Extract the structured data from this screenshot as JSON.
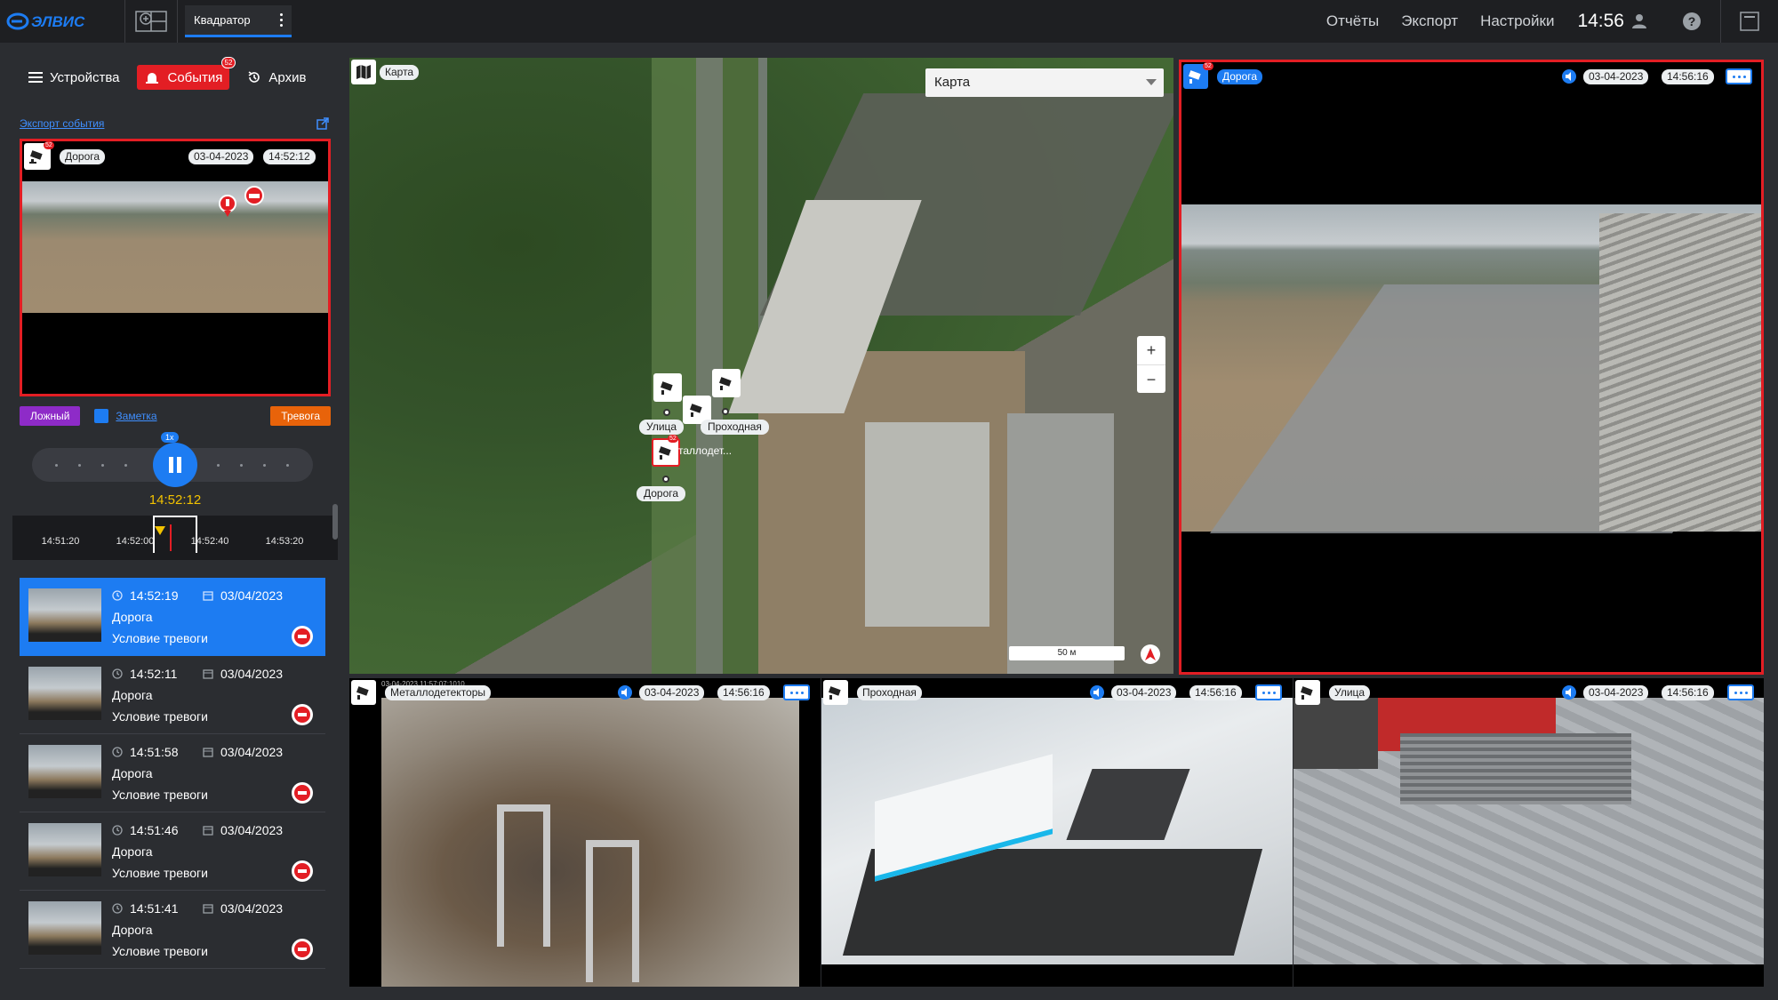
{
  "app": {
    "logo_text": "ЭЛВИС",
    "layout_tab": "Квадратор",
    "nav": [
      "Отчёты",
      "Экспорт",
      "Настройки"
    ],
    "clock": "14:56",
    "help": "?"
  },
  "left": {
    "tabs": [
      {
        "label": "Устройства",
        "icon": "menu-icon"
      },
      {
        "label": "События",
        "icon": "alarm-light-icon",
        "badge": "52"
      },
      {
        "label": "Архив",
        "icon": "history-icon"
      }
    ],
    "export_link": "Экспорт события",
    "preview": {
      "camera": "Дорога",
      "date": "03-04-2023",
      "time": "14:52:12",
      "badge": "52"
    },
    "actions": {
      "false_label": "Ложный",
      "note_label": "Заметка",
      "alarm_label": "Тревога"
    },
    "player": {
      "speed": "1x",
      "current_time": "14:52:12"
    },
    "timeline_ticks": [
      "14:51:20",
      "14:52:00",
      "14:52:40",
      "14:53:20"
    ],
    "events": [
      {
        "time": "14:52:19",
        "date": "03/04/2023",
        "camera": "Дорога",
        "condition": "Условие тревоги"
      },
      {
        "time": "14:52:11",
        "date": "03/04/2023",
        "camera": "Дорога",
        "condition": "Условие тревоги"
      },
      {
        "time": "14:51:58",
        "date": "03/04/2023",
        "camera": "Дорога",
        "condition": "Условие тревоги"
      },
      {
        "time": "14:51:46",
        "date": "03/04/2023",
        "camera": "Дорога",
        "condition": "Условие тревоги"
      },
      {
        "time": "14:51:41",
        "date": "03/04/2023",
        "camera": "Дорога",
        "condition": "Условие тревоги"
      }
    ]
  },
  "map": {
    "title": "Карта",
    "select_value": "Карта",
    "zoom_in": "+",
    "zoom_out": "−",
    "scale": "50 м",
    "pins": [
      {
        "label": "Улица"
      },
      {
        "label": "Проходная"
      },
      {
        "label": "таллодет..."
      },
      {
        "label": "Дорога"
      }
    ],
    "pin_badge": "52"
  },
  "tiles": {
    "main": {
      "name": "Дорога",
      "date": "03-04-2023",
      "time": "14:56:16",
      "badge": "52"
    },
    "metal": {
      "name": "Металлодетекторы",
      "date": "03-04-2023",
      "time": "14:56:16",
      "overlay_date": "03-04-2023 11:57:07:1010"
    },
    "gate": {
      "name": "Проходная",
      "date": "03-04-2023",
      "time": "14:56:16"
    },
    "street": {
      "name": "Улица",
      "date": "03-04-2023",
      "time": "14:56:16"
    }
  },
  "colors": {
    "accent": "#1d7cf2",
    "alarm": "#e31e24",
    "warning": "#e8630a",
    "false": "#8e2bc8",
    "time": "#f2c200"
  }
}
